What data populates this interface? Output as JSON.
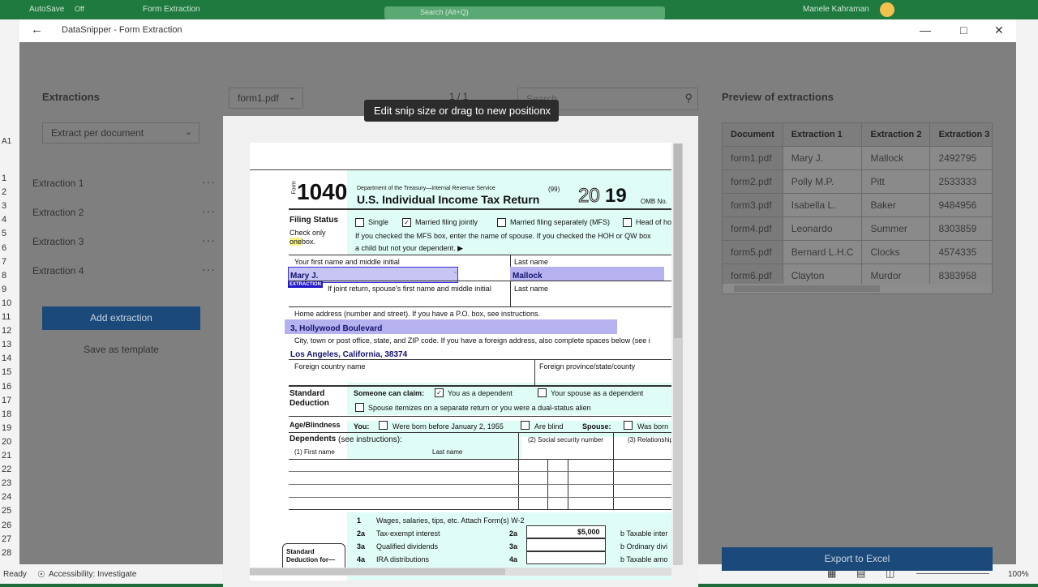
{
  "excel": {
    "autosave": "AutoSave",
    "autosave_state": "Off",
    "doc_name": "Form Extraction",
    "search_placeholder": "Search (Alt+Q)",
    "user": "Manele Kahraman",
    "cell_ref": "A1",
    "row_numbers": [
      "1",
      "2",
      "3",
      "4",
      "5",
      "6",
      "7",
      "8",
      "9",
      "10",
      "11",
      "12",
      "13",
      "14",
      "15",
      "16",
      "17",
      "18",
      "19",
      "20",
      "21",
      "22",
      "23",
      "24",
      "25",
      "26",
      "27",
      "28"
    ],
    "status_ready": "Ready",
    "status_accessibility": "Accessibility: Investigate",
    "zoom": "100%"
  },
  "dialog": {
    "title": "DataSnipper - Form Extraction",
    "back_icon": "arrow-left-icon",
    "minimize_label": "—",
    "maximize_label": "□",
    "close_label": "✕"
  },
  "left_panel": {
    "title": "Extractions",
    "mode_select": "Extract per document",
    "items": [
      {
        "label": "Extraction 1"
      },
      {
        "label": "Extraction 2"
      },
      {
        "label": "Extraction 3"
      },
      {
        "label": "Extraction 4"
      }
    ],
    "more_label": "···",
    "add_button": "Add extraction",
    "save_template": "Save as template"
  },
  "viewer": {
    "file_select": "form1.pdf",
    "page_indicator": "1 / 1",
    "search_placeholder": "Search",
    "tooltip": "Edit snip size or drag to new position",
    "tooltip_close": "x"
  },
  "form": {
    "form_label": "Form",
    "form_number": "1040",
    "dept": "Department of the Treasury—Internal Revenue Service",
    "code": "(99)",
    "title": "U.S. Individual Income Tax Return",
    "year_a": "20",
    "year_b": "19",
    "omb": "OMB No.",
    "filing_status": "Filing Status",
    "check_only": "Check only",
    "one_box_a": "one",
    "one_box_b": " box.",
    "fs_single": "Single",
    "fs_mfj": "Married filing jointly",
    "fs_mfs": "Married filing separately (MFS)",
    "fs_hoh": "Head of ho",
    "mfs_note": "If you checked the MFS box, enter the name of spouse. If you checked the HOH or QW box",
    "child_note": "a child but not your dependent. ▶",
    "first_name_label": "Your first name and middle initial",
    "last_name_label": "Last name",
    "first_name_value": "Mary J.",
    "last_name_value": "Mallock",
    "extraction_tag": "EXTRACTION",
    "spouse_label": "If joint return, spouse's first name and middle initial",
    "spouse_last_label": "Last name",
    "address_label": "Home address (number and street). If you have a P.O. box, see instructions.",
    "address_value": "3, Hollywood Boulevard",
    "city_label": "City, town or post office, state, and ZIP code. If you have a foreign address, also complete spaces below (see i",
    "city_value": "Los Angeles, California, 38374",
    "foreign_country": "Foreign country name",
    "foreign_province": "Foreign province/state/county",
    "std_deduction_a": "Standard",
    "std_deduction_b": "Deduction",
    "someone_can_claim": "Someone can claim:",
    "you_dependent": "You as a dependent",
    "spouse_dependent": "Your spouse as a dependent",
    "spouse_itemizes": "Spouse itemizes on a separate return or you were a dual-status alien",
    "age_blindness": "Age/Blindness",
    "you": "You:",
    "born_before": "Were born before January 2, 1955",
    "are_blind": "Are blind",
    "spouse": "Spouse:",
    "was_born": "Was born",
    "dependents": "Dependents",
    "see_instructions": " (see instructions):",
    "dep_first": "(1) First name",
    "dep_last": "Last name",
    "dep_ssn": "(2) Social security number",
    "dep_rel": "(3) Relationship",
    "line1_num": "1",
    "line1": "Wages, salaries, tips, etc. Attach Form(s) W-2",
    "line2a_num": "2a",
    "line2a": "Tax-exempt interest",
    "line2a_box": "2a",
    "line2a_value": "$5,000",
    "line2b": "b  Taxable inter",
    "line3a_num": "3a",
    "line3a": "Qualified dividends",
    "line3a_box": "3a",
    "line3b": "b  Ordinary divi",
    "line4a_num": "4a",
    "line4a": "IRA distributions",
    "line4a_box": "4a",
    "line4b": "b  Taxable amo",
    "std_ded_for_a": "Standard",
    "std_ded_for_b": "Deduction for—"
  },
  "preview": {
    "title": "Preview of extractions",
    "columns": [
      "Document",
      "Extraction 1",
      "Extraction 2",
      "Extraction 3"
    ],
    "rows": [
      [
        "form1.pdf",
        "Mary J.",
        "Mallock",
        "2492795"
      ],
      [
        "form2.pdf",
        "Polly M.P.",
        "Pitt",
        "2533333"
      ],
      [
        "form3.pdf",
        "Isabella L.",
        "Baker",
        "9484956"
      ],
      [
        "form4.pdf",
        "Leonardo",
        "Summer",
        "8303859"
      ],
      [
        "form5.pdf",
        "Bernard L.H.C",
        "Clocks",
        "4574335"
      ],
      [
        "form6.pdf",
        "Clayton",
        "Murdor",
        "8383958"
      ]
    ],
    "export_button": "Export to Excel"
  }
}
